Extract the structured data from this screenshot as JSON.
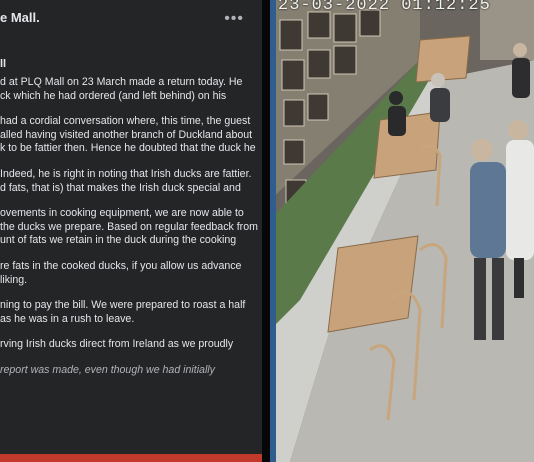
{
  "post": {
    "title_fragment": "e Mall.",
    "more_icon": "more-horizontal-icon",
    "subtitle_fragment": "ll",
    "paragraphs": [
      "d at PLQ Mall on 23 March made a return today. He\nck which he had ordered (and left behind) on his",
      "had a cordial conversation where, this time, the guest\nalled having visited another branch of Duckland about\nk to be fattier then. Hence he doubted that the duck he",
      "Indeed, he is right in noting that Irish ducks are fattier.\nd fats, that is) that makes the Irish duck special and",
      "ovements in cooking equipment, we are now able to\nthe ducks we prepare. Based on regular feedback from\nunt of fats we retain in the duck during the cooking",
      "re fats in the cooked ducks, if you allow us advance\nliking.",
      "ning to pay the bill. We were prepared to roast a half\nas he was in a rush to leave.",
      "rving Irish ducks direct from Ireland as we proudly"
    ],
    "italic_note": "report was made, even though we had initially"
  },
  "cctv": {
    "timestamp": "23-03-2022 01:12:25",
    "colors": {
      "wall": "#5b7a4a",
      "floor": "#bfbfbc",
      "table": "#c7a27a"
    }
  }
}
